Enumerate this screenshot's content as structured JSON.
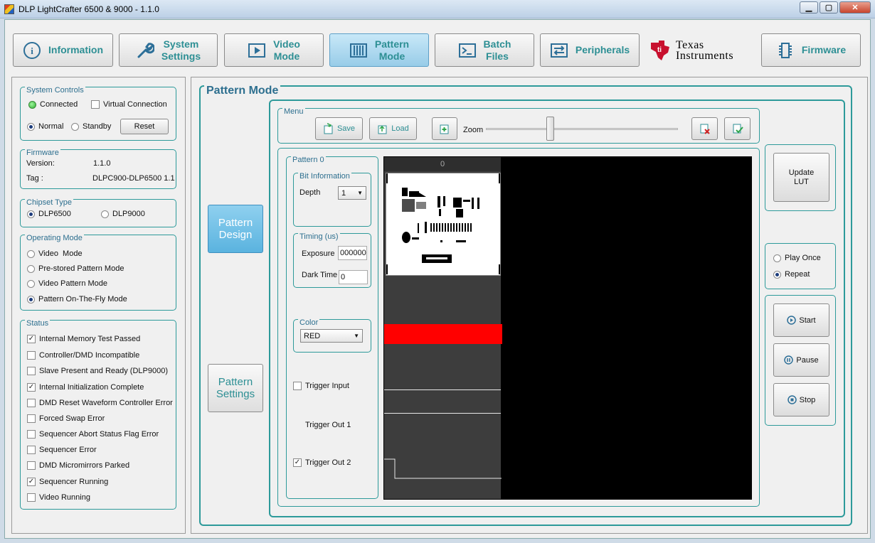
{
  "window": {
    "title": "DLP LightCrafter 6500 & 9000 - 1.1.0"
  },
  "nav": {
    "information": "Information",
    "system_settings_line1": "System",
    "system_settings_line2": "Settings",
    "video_mode_line1": "Video",
    "video_mode_line2": "Mode",
    "pattern_mode_line1": "Pattern",
    "pattern_mode_line2": "Mode",
    "batch_files_line1": "Batch",
    "batch_files_line2": "Files",
    "peripherals": "Peripherals",
    "firmware": "Firmware",
    "active": "Pattern Mode"
  },
  "brand": {
    "line1": "Texas",
    "line2": "Instruments",
    "color": "#c8102e"
  },
  "system_controls": {
    "label": "System Controls",
    "connected": "Connected",
    "virtual_connection": "Virtual Connection",
    "virtual_connection_checked": false,
    "normal": "Normal",
    "standby": "Standby",
    "power_mode": "Normal",
    "reset": "Reset"
  },
  "firmware_info": {
    "label": "Firmware",
    "version_label": "Version:",
    "version_value": "1.1.0",
    "tag_label": "Tag :",
    "tag_value": "DLPC900-DLP6500 1.1"
  },
  "chipset": {
    "label": "Chipset Type",
    "options": [
      "DLP6500",
      "DLP9000"
    ],
    "selected": "DLP6500"
  },
  "operating_mode": {
    "label": "Operating Mode",
    "options": [
      "Video  Mode",
      "Pre-stored Pattern Mode",
      "Video Pattern Mode",
      "Pattern On-The-Fly Mode"
    ],
    "selected": "Pattern On-The-Fly Mode"
  },
  "status": {
    "label": "Status",
    "items": [
      {
        "label": "Internal Memory Test Passed",
        "checked": true
      },
      {
        "label": "Controller/DMD Incompatible",
        "checked": false
      },
      {
        "label": "Slave Present and Ready (DLP9000)",
        "checked": false
      },
      {
        "label": "Internal Initialization Complete",
        "checked": true
      },
      {
        "label": "DMD Reset Waveform Controller Error",
        "checked": false
      },
      {
        "label": "Forced Swap Error",
        "checked": false
      },
      {
        "label": "Sequencer Abort Status Flag Error",
        "checked": false
      },
      {
        "label": "Sequencer Error",
        "checked": false
      },
      {
        "label": "DMD Micromirrors Parked",
        "checked": false
      },
      {
        "label": "Sequencer Running",
        "checked": true
      },
      {
        "label": "Video Running",
        "checked": false
      }
    ]
  },
  "pattern_mode": {
    "title": "Pattern Mode",
    "design_line1": "Pattern",
    "design_line2": "Design",
    "settings_line1": "Pattern",
    "settings_line2": "Settings",
    "menu_label": "Menu",
    "save": "Save",
    "load": "Load",
    "zoom_label": "Zoom",
    "zoom_level": 0.35
  },
  "pattern": {
    "label": "Pattern 0",
    "bit_info_label": "Bit Information",
    "depth_label": "Depth",
    "depth_value": "1",
    "timing_label": "Timing (us)",
    "exposure_label": "Exposure",
    "exposure_value": "000000",
    "dark_time_label": "Dark Time",
    "dark_time_value": "0",
    "color_label": "Color",
    "color_value": "RED",
    "trigger_input": "Trigger Input",
    "trigger_input_checked": false,
    "trigger_out1": "Trigger Out 1",
    "trigger_out2": "Trigger Out 2",
    "trigger_out2_checked": true,
    "column_header": "0"
  },
  "lut": {
    "update_line1": "Update",
    "update_line2": "LUT"
  },
  "playback": {
    "play_once": "Play Once",
    "repeat": "Repeat",
    "selected": "Repeat"
  },
  "sequence": {
    "start": "Start",
    "pause": "Pause",
    "stop": "Stop"
  }
}
